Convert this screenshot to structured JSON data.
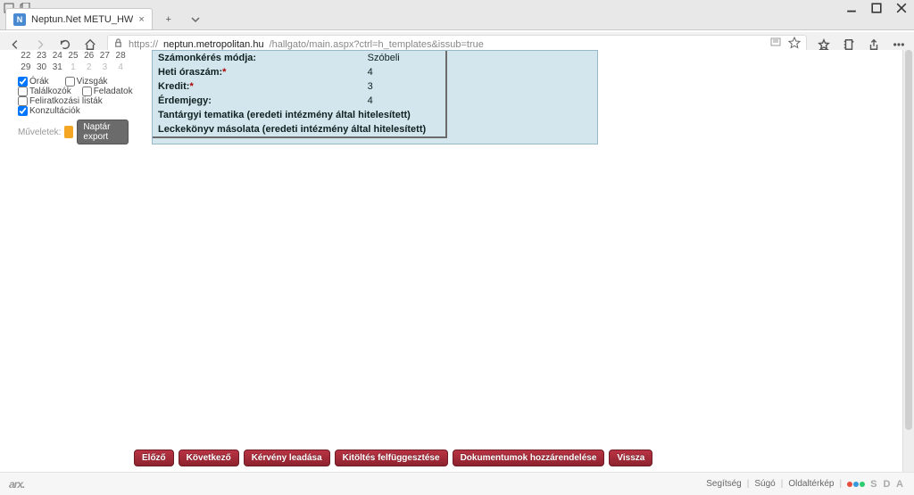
{
  "tab": {
    "title": "Neptun.Net METU_HW",
    "favicon_letter": "N"
  },
  "url": {
    "scheme": "https://",
    "host": "neptun.metropolitan.hu",
    "path": "/hallgato/main.aspx?ctrl=h_templates&issub=true"
  },
  "calendar": {
    "rows": [
      [
        "22",
        "23",
        "24",
        "25",
        "26",
        "27",
        "28"
      ],
      [
        "29",
        "30",
        "31",
        "1",
        "2",
        "3",
        "4"
      ]
    ],
    "off_start_row2_index": 3
  },
  "checks": {
    "orak": "Órák",
    "vizsgak": "Vizsgák",
    "talalkozok": "Találkozók",
    "feladatok": "Feladatok",
    "feliratkozasi": "Feliratkozási listák",
    "konzultaciok": "Konzultációk"
  },
  "ops": {
    "label": "Műveletek:",
    "export": "Naptár export"
  },
  "info": {
    "szamonkeres_lbl": "Számonkérés módja:",
    "szamonkeres_val": "Szóbeli",
    "hetioraszam_lbl": "Heti óraszám:",
    "hetioraszam_val": "4",
    "kredit_lbl": "Kredit:",
    "kredit_val": "3",
    "erdemjegy_lbl": "Érdemjegy:",
    "erdemjegy_val": "4",
    "tematika": "Tantárgyi tematika (eredeti intézmény által hitelesített)",
    "leckekonyv": "Leckekönyv másolata (eredeti intézmény által hitelesített)"
  },
  "actions": {
    "elozo": "Előző",
    "kovetkezo": "Következő",
    "kerveny": "Kérvény leadása",
    "kitoltes": "Kitöltés felfüggesztése",
    "dokumentumok": "Dokumentumok hozzárendelése",
    "vissza": "Vissza"
  },
  "footer": {
    "brand": "arx.",
    "segitseg": "Segítség",
    "sugo": "Súgó",
    "oldalterkep": "Oldaltérkép",
    "sda": "S D A"
  }
}
